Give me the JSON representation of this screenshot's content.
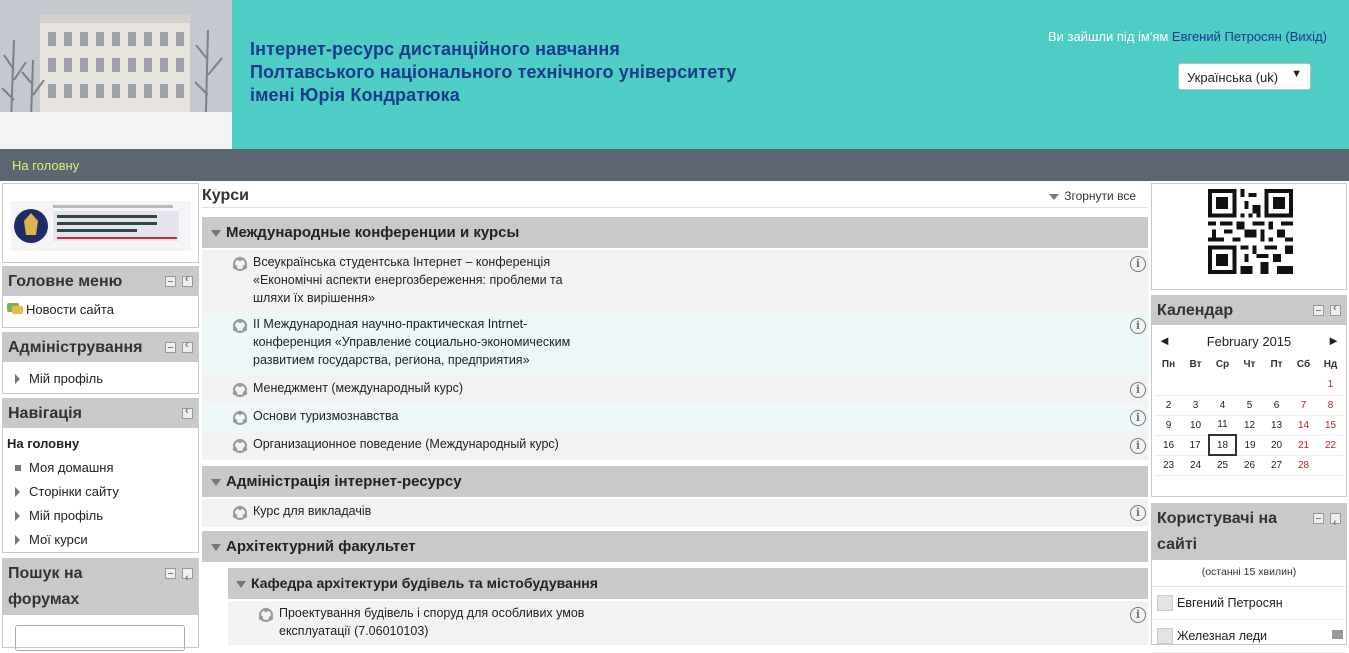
{
  "header": {
    "title_line1": "Інтернет-ресурс дистанційного навчання",
    "title_line2": "Полтавського національного технічного університету",
    "title_line3": "імені Юрія Кондратюка",
    "login_prefix": "Ви зайшли під ім'ям",
    "user_name": "Евгений Петросян",
    "logout_open": "(",
    "logout_label": "Вихід",
    "logout_close": ")",
    "language": "Українська (uk)",
    "language_arrow": "▼"
  },
  "navbar": {
    "home_label": "На головну"
  },
  "left": {
    "main_menu": {
      "title": "Головне меню",
      "items": [
        "Новости сайта"
      ]
    },
    "admin": {
      "title": "Адміністрування",
      "items": [
        "Мій профіль"
      ]
    },
    "navigation": {
      "title": "Навігація",
      "home": "На головну",
      "items": [
        "Моя домашня",
        "Сторінки сайту",
        "Мій профіль",
        "Мої курси"
      ]
    },
    "forum_search": {
      "title_line1": "Пошук на",
      "title_line2": "форумах"
    }
  },
  "center": {
    "title": "Курси",
    "collapse_all": "Згорнути все",
    "categories": [
      {
        "name": "Международные конференции и курсы"
      },
      {
        "name": "Адміністрація інтернет-ресурсу"
      },
      {
        "name": "Архітектурний факультет"
      }
    ],
    "subcategories": [
      {
        "name": "Кафедра архітектури будівель та містобудування"
      }
    ],
    "courses": [
      {
        "lines": [
          "Всеукраїнська студентська Інтернет – конференція",
          "«Економічні аспекти енергозбереження: проблеми та",
          "шляхи їх вирішення»"
        ]
      },
      {
        "lines": [
          "II Международная научно-практическая Intrnet-",
          "конференция «Управление социально-экономическим",
          "развитием государства, региона, предприятия»"
        ]
      },
      {
        "lines": [
          "Менеджмент (международный курс)"
        ]
      },
      {
        "lines": [
          "Основи туризмознавства"
        ]
      },
      {
        "lines": [
          "Организационное поведение (Международный курс)"
        ]
      },
      {
        "lines": [
          "Курс для викладачів"
        ]
      },
      {
        "lines": [
          "Проектування будівель і споруд для особливих умов",
          "експлуатації (7.06010103)"
        ]
      }
    ],
    "info_symbol": "i"
  },
  "right": {
    "calendar": {
      "title": "Календар",
      "month": "February 2015",
      "prev": "◄",
      "next": "►",
      "weekdays": [
        "Пн",
        "Вт",
        "Ср",
        "Чт",
        "Пт",
        "Сб",
        "Нд"
      ],
      "today": "18",
      "weeks": [
        [
          "",
          "",
          "",
          "",
          "",
          "",
          "1"
        ],
        [
          "2",
          "3",
          "4",
          "5",
          "6",
          "7",
          "8"
        ],
        [
          "9",
          "10",
          "11",
          "12",
          "13",
          "14",
          "15"
        ],
        [
          "16",
          "17",
          "18",
          "19",
          "20",
          "21",
          "22"
        ],
        [
          "23",
          "24",
          "25",
          "26",
          "27",
          "28",
          ""
        ]
      ]
    },
    "online_users": {
      "title_line1": "Користувачі на",
      "title_line2": "сайті",
      "subtitle": "(останні 15 хвилин)",
      "users": [
        "Евгений Петросян",
        "Железная леди"
      ]
    }
  },
  "colors": {
    "header_bg": "#4ecdc4",
    "title_color": "#1a3a8c",
    "navbar_bg": "#5b6670",
    "nav_link": "#d9f27a"
  }
}
